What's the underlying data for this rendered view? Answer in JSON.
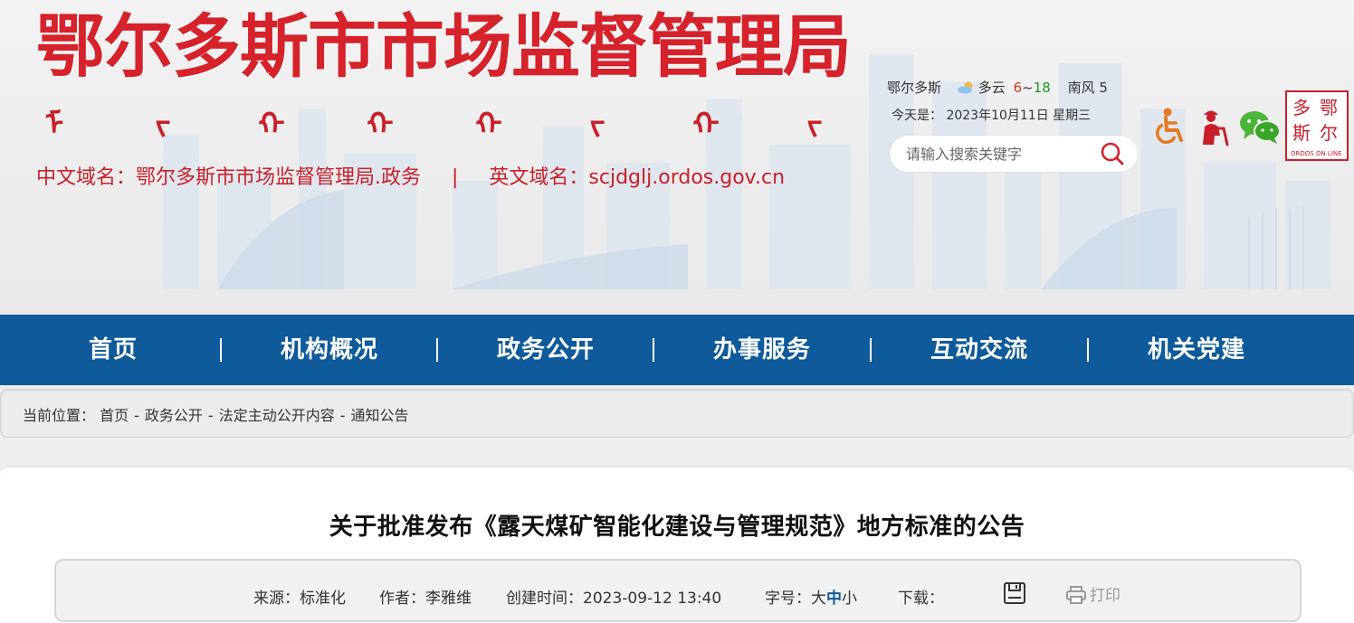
{
  "header": {
    "site_title": "鄂尔多斯市市场监督管理局",
    "mongolian_glyphs": [
      "ᠮ",
      "ᠵ",
      "ᠬ",
      "ᠬ",
      "ᠬ",
      "ᠵ",
      "ᠬ",
      "ᠵ"
    ],
    "domain_cn": "中文域名：鄂尔多斯市市场监督管理局.政务",
    "domain_sep": "|",
    "domain_en": "英文域名：scjdglj.ordos.gov.cn",
    "weather": {
      "city": "鄂尔多斯",
      "condition": "多云",
      "temp_low": "6",
      "temp_sep": "~",
      "temp_high": "18",
      "wind": "南风",
      "wind_tail": "5"
    },
    "today": "今天是： 2023年10月11日 星期三",
    "search": {
      "placeholder": "请输入搜索关键字"
    },
    "logo_lines": [
      "鄂",
      "尔",
      "多",
      "斯"
    ],
    "logo_caption": "ORDOS ON LINE",
    "brand_red": "#c8202a"
  },
  "nav": {
    "items": [
      "首页",
      "机构概况",
      "政务公开",
      "办事服务",
      "互动交流",
      "机关党建"
    ],
    "color": "#0f5a9a"
  },
  "breadcrumb": {
    "label": "当前位置：",
    "items": [
      "首页",
      "政务公开",
      "法定主动公开内容",
      "通知公告"
    ],
    "separator": "-"
  },
  "article": {
    "title": "关于批准发布《露天煤矿智能化建设与管理规范》地方标准的公告",
    "meta": {
      "source_label": "来源：",
      "source": "标准化",
      "author_label": "作者：",
      "author": "李雅维",
      "created_label": "创建时间：",
      "created": "2023-09-12 13:40",
      "fontsize_label": "字号：",
      "size_large": "大",
      "size_mid": "中",
      "size_small": "小",
      "download_label": "下载：",
      "print_label": "打印"
    }
  }
}
